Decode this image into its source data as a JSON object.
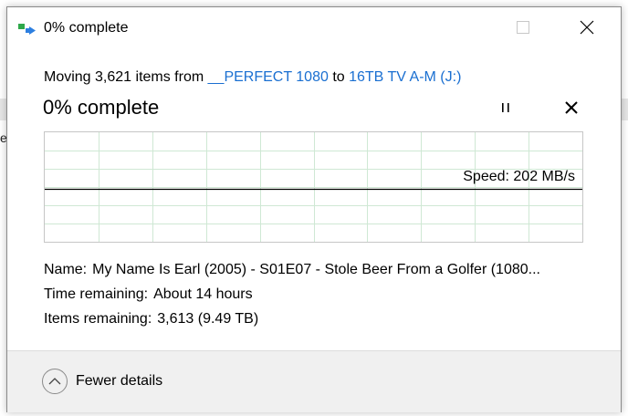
{
  "window": {
    "title": "0% complete",
    "background_fragment": "e"
  },
  "transfer": {
    "prefix": "Moving 3,621 items from",
    "source": "__PERFECT 1080",
    "connector": "to",
    "destination": "16TB TV A-M (J:)"
  },
  "progress": {
    "heading": "0% complete",
    "percent": 0,
    "speed_label": "Speed: 202 MB/s",
    "speed_line_level": 0.52
  },
  "details": {
    "name_label": "Name:",
    "name_value": "My Name Is Earl (2005) - S01E07 - Stole Beer From a Golfer (1080...",
    "time_label": "Time remaining:",
    "time_value": "About 14 hours",
    "items_label": "Items remaining:",
    "items_value": "3,613 (9.49 TB)"
  },
  "footer": {
    "toggle_label": "Fewer details"
  },
  "colors": {
    "link": "#1a6fd1",
    "grid": "#cfe8d4",
    "speed_line": "#000000",
    "icon_green": "#2ea84a",
    "icon_blue": "#2d7fe0"
  },
  "icons": {
    "app": "file-move-icon",
    "minimize": "minimize-icon",
    "maximize": "maximize-icon",
    "close": "close-icon",
    "pause": "pause-icon",
    "cancel": "cancel-icon",
    "toggle": "chevron-up-icon"
  }
}
